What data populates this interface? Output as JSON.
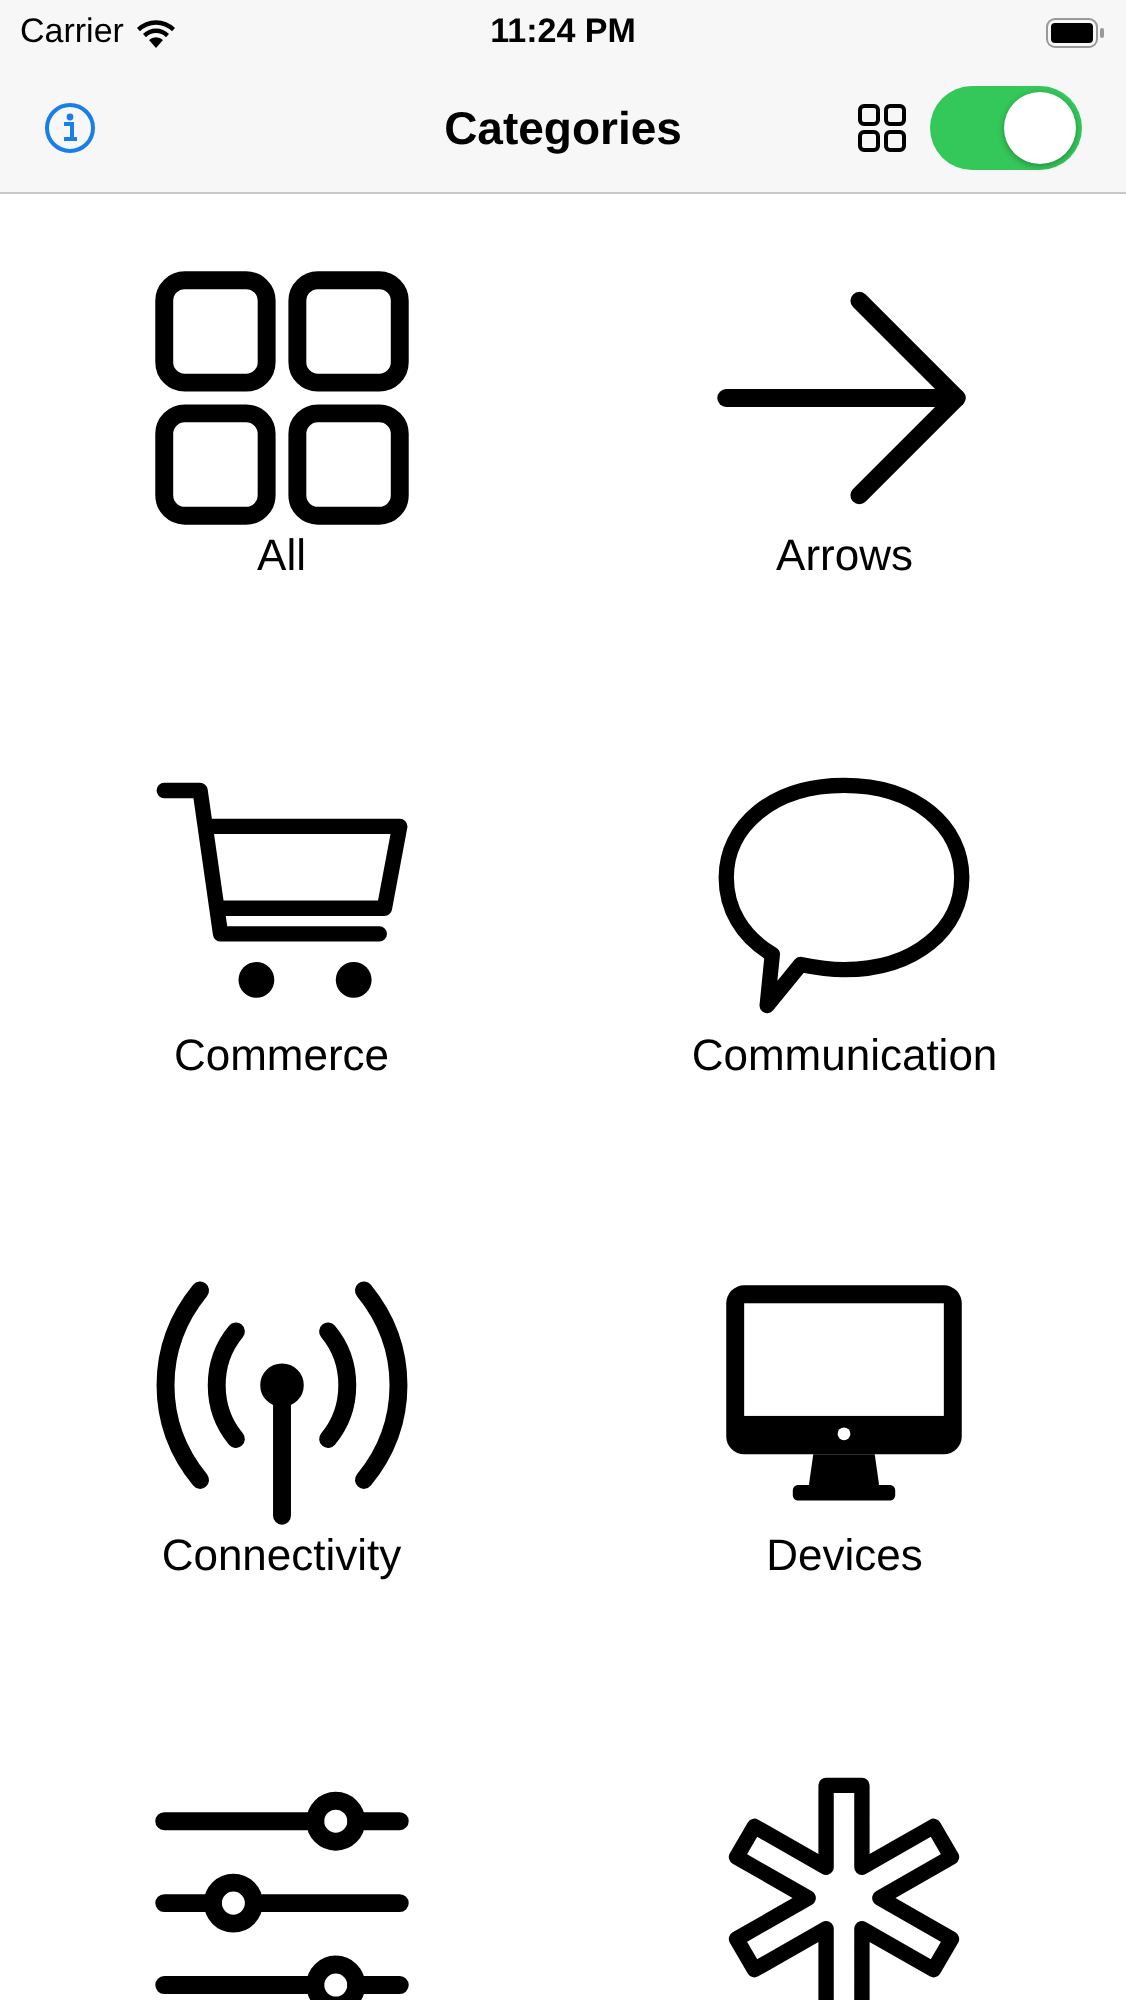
{
  "status_bar": {
    "carrier": "Carrier",
    "time": "11:24 PM"
  },
  "nav_bar": {
    "title": "Categories",
    "toggle": {
      "on": true
    }
  },
  "categories": [
    {
      "kind": "grid",
      "label": "All"
    },
    {
      "kind": "arrow",
      "label": "Arrows"
    },
    {
      "kind": "cart",
      "label": "Commerce"
    },
    {
      "kind": "bubble",
      "label": "Communication"
    },
    {
      "kind": "antenna",
      "label": "Connectivity"
    },
    {
      "kind": "monitor",
      "label": "Devices"
    },
    {
      "kind": "sliders"
    },
    {
      "kind": "asterisk"
    }
  ]
}
